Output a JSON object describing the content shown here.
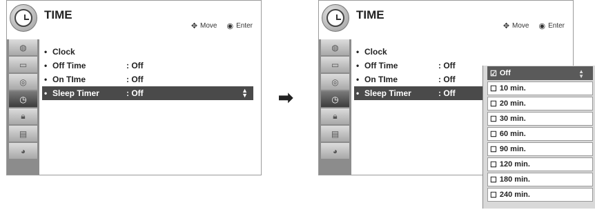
{
  "left_screen": {
    "title": "TIME",
    "hint_move": "Move",
    "hint_enter": "Enter",
    "menu": [
      {
        "label": "Clock",
        "value": ""
      },
      {
        "label": "Off Time",
        "value": ": Off"
      },
      {
        "label": "On TIme",
        "value": ": Off"
      },
      {
        "label": "Sleep Timer",
        "value": ": Off"
      }
    ]
  },
  "right_screen": {
    "title": "TIME",
    "hint_move": "Move",
    "hint_enter": "Enter",
    "menu": [
      {
        "label": "Clock",
        "value": ""
      },
      {
        "label": "Off Time",
        "value": ": Off"
      },
      {
        "label": "On TIme",
        "value": ": Off"
      },
      {
        "label": "Sleep Timer",
        "value": ": Off"
      }
    ],
    "dropdown": [
      "Off",
      "10 min.",
      "20 min.",
      "30 min.",
      "60 min.",
      "90 min.",
      "120 min.",
      "180 min.",
      "240 min."
    ]
  },
  "icons": {
    "move": "four-way-arrow-icon",
    "enter": "enter-circle-icon",
    "transition": "right-arrow-icon"
  }
}
